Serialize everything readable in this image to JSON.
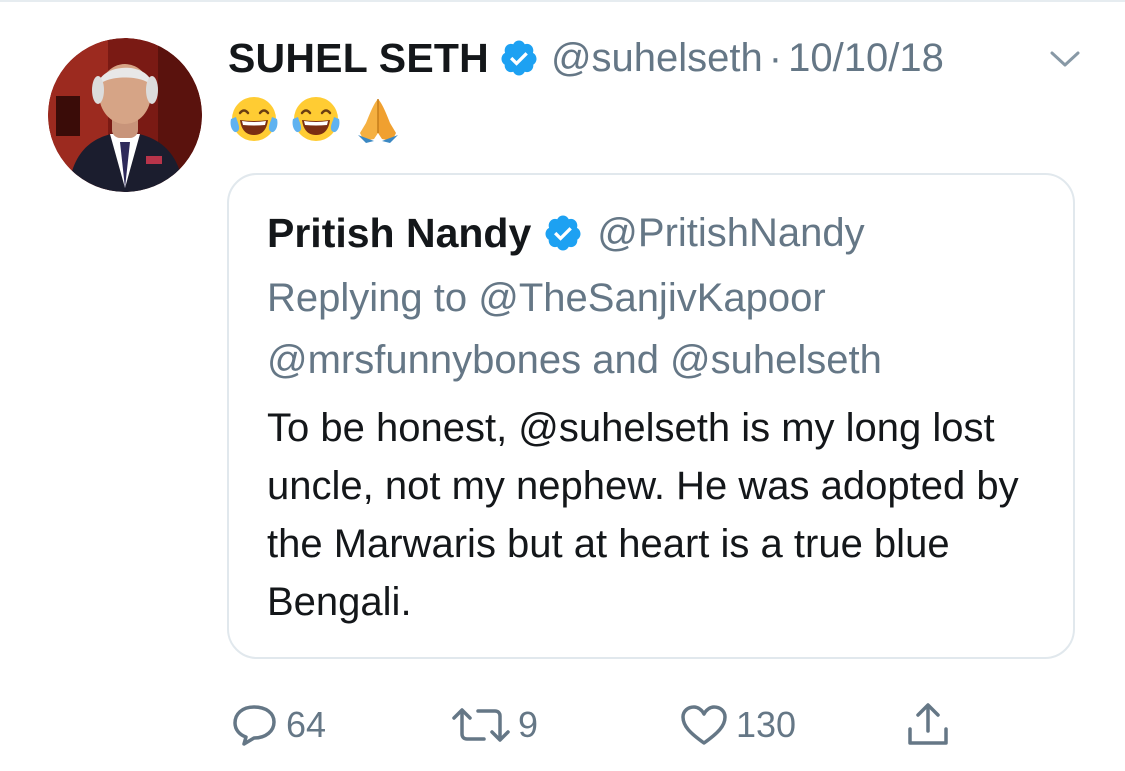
{
  "tweet": {
    "display_name": "SUHEL SETH",
    "handle": "@suhelseth",
    "separator": "·",
    "date": "10/10/18",
    "emoji_text": "😂😂🙏",
    "emojis": [
      "face-with-tears-of-joy",
      "face-with-tears-of-joy",
      "folded-hands"
    ]
  },
  "quoted_tweet": {
    "display_name": "Pritish Nandy",
    "handle": "@PritishNandy",
    "replying_to": "Replying to @TheSanjivKapoor @mrsfunnybones and @suhelseth",
    "body": "To be honest, @suhelseth is my long lost uncle, not my nephew. He was adopted by the Marwaris but at heart is a true blue Bengali."
  },
  "actions": {
    "reply_count": "64",
    "retweet_count": "9",
    "like_count": "130"
  },
  "colors": {
    "verified_blue": "#1da1f2",
    "secondary_text": "#657786",
    "primary_text": "#14171a",
    "border": "#e1e8ed"
  }
}
